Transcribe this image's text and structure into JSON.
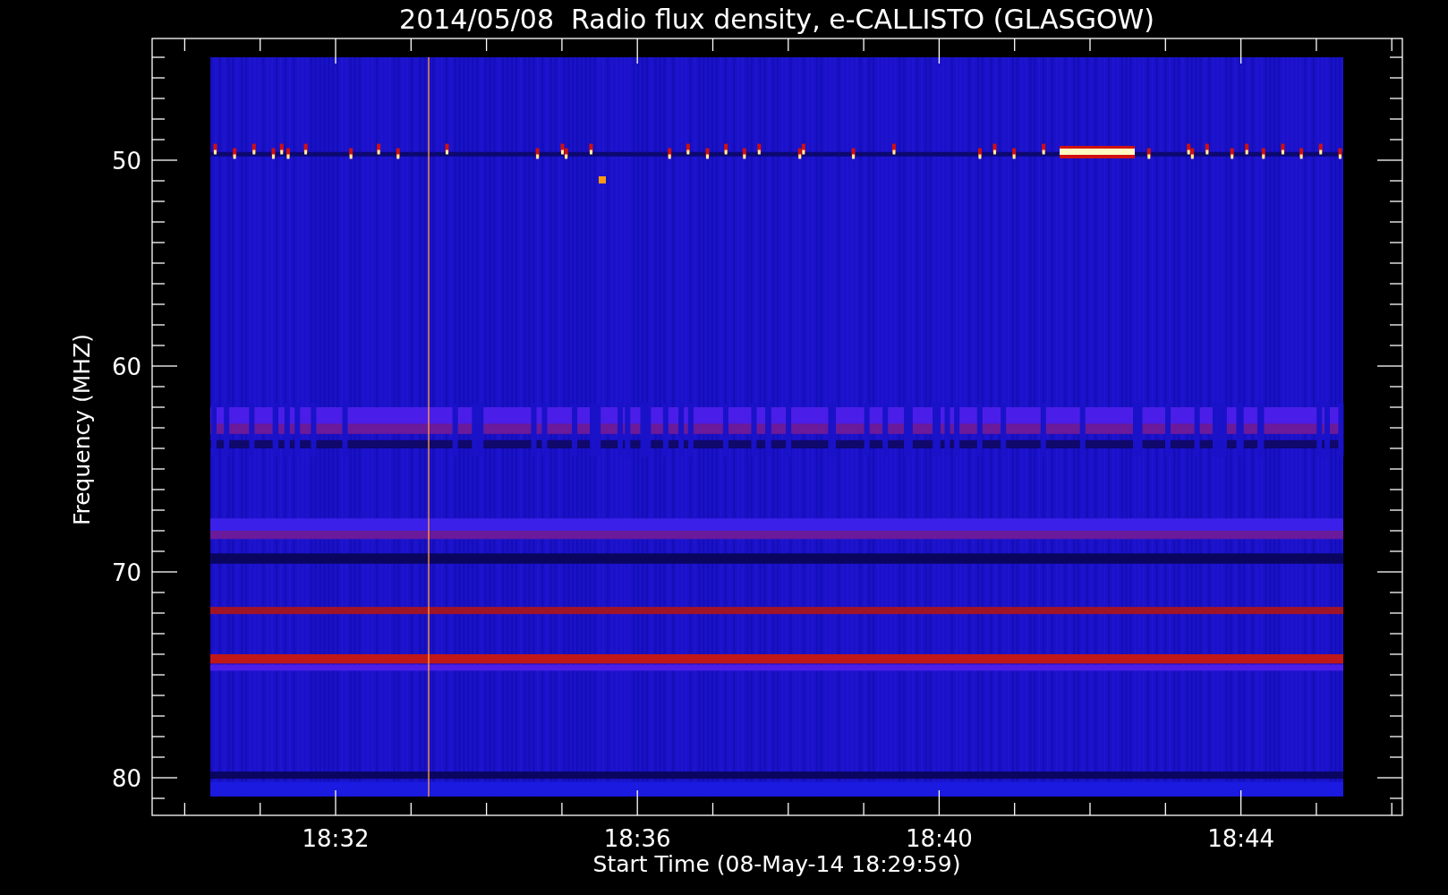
{
  "title": "2014/05/08  Radio flux density, e-CALLISTO (GLASGOW)",
  "plot": {
    "ylabel": "Frequency (MHZ)",
    "xlabel": "Start Time (08-May-14 18:29:59)",
    "yticks": [
      "50",
      "60",
      "70",
      "80"
    ],
    "xticks": [
      "18:32",
      "18:36",
      "18:40",
      "18:44"
    ]
  }
}
